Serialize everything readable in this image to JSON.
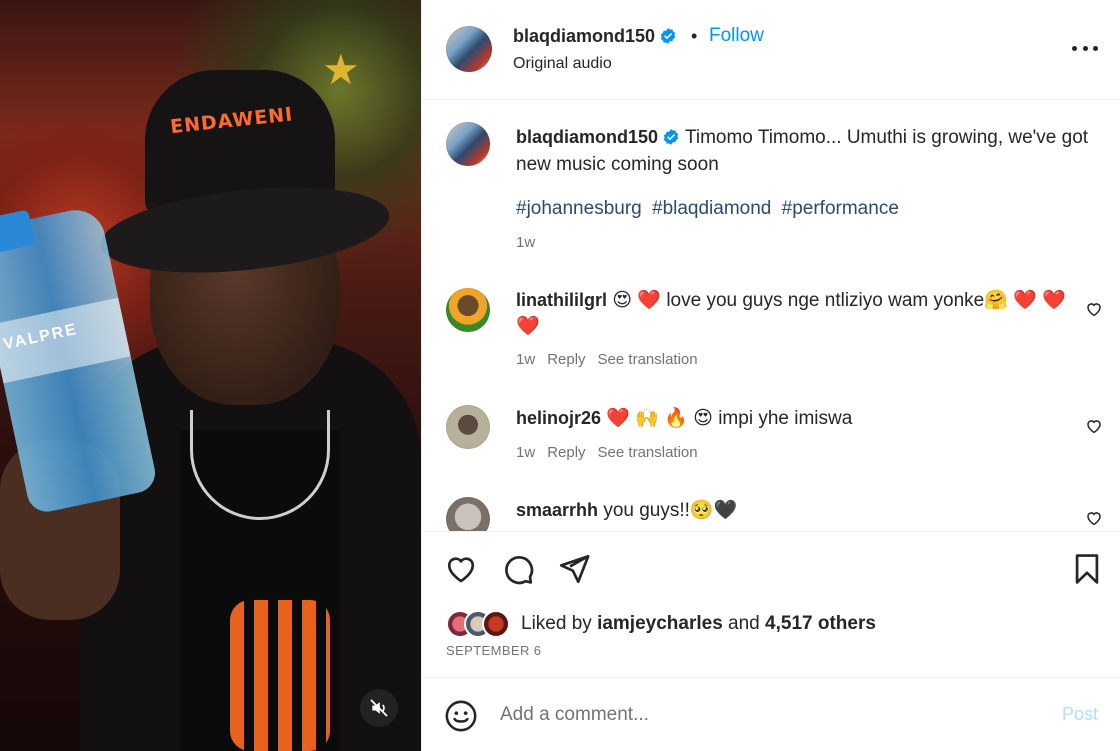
{
  "media": {
    "hat_text": "ENDAWENI",
    "bottle_text": "VALPRE"
  },
  "header": {
    "username": "blaqdiamond150",
    "separator": "•",
    "follow_label": "Follow",
    "audio_label": "Original audio"
  },
  "caption": {
    "username": "blaqdiamond150",
    "text": "Timomo Timomo... Umuthi is growing, we've got new music coming soon",
    "hashtags": [
      "#johannesburg",
      "#blaqdiamond",
      "#performance"
    ],
    "time": "1w"
  },
  "comments": [
    {
      "username": "linathililgrl",
      "text": "😍 ❤️ love you guys nge ntliziyo wam yonke🤗 ❤️ ❤️ ❤️",
      "time": "1w",
      "reply": "Reply",
      "translate": "See translation"
    },
    {
      "username": "helinojr26",
      "text": "❤️ 🙌 🔥 😍 impi yhe imiswa",
      "time": "1w",
      "reply": "Reply",
      "translate": "See translation"
    },
    {
      "username": "smaarrhh",
      "text": "you guys!!🥺🖤"
    }
  ],
  "likes": {
    "prefix": "Liked by",
    "user": "iamjeycharles",
    "middle": "and",
    "others": "4,517 others"
  },
  "date": "SEPTEMBER 6",
  "composer": {
    "placeholder": "Add a comment...",
    "post_label": "Post"
  },
  "icons": {
    "verified": "verified-badge-icon",
    "like": "heart-icon",
    "comment": "comment-icon",
    "share": "share-icon",
    "save": "bookmark-icon",
    "emoji": "emoji-icon",
    "mute": "speaker-muted-icon",
    "more": "more-options-icon"
  },
  "colors": {
    "accent": "#0095f6",
    "hashtag": "#2b4b6e",
    "secondary_text": "#737373",
    "post_disabled": "#b2dffc"
  }
}
